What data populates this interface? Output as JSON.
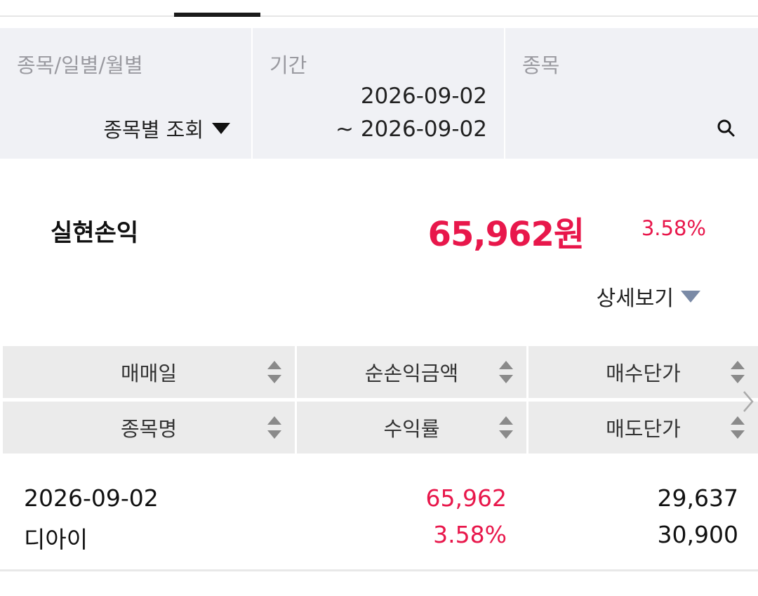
{
  "filters": {
    "mode_label": "종목/일별/월별",
    "mode_value": "종목별 조회",
    "period_label": "기간",
    "period_start": "2026-09-02",
    "period_end": "~ 2026-09-02",
    "stock_label": "종목"
  },
  "summary": {
    "title": "실현손익",
    "amount": "65,962원",
    "rate": "3.58%",
    "detail_toggle": "상세보기"
  },
  "table": {
    "headers_row1": [
      "매매일",
      "순손익금액",
      "매수단가"
    ],
    "headers_row2": [
      "종목명",
      "수익률",
      "매도단가"
    ],
    "rows": [
      {
        "trade_date": "2026-09-02",
        "stock_name": "디아이",
        "net_profit": "65,962",
        "profit_rate": "3.58%",
        "buy_price": "29,637",
        "sell_price": "30,900"
      }
    ]
  },
  "colors": {
    "profit_red": "#e8174b",
    "filter_bg": "#f0f1f5",
    "header_bg": "#ebebeb"
  }
}
